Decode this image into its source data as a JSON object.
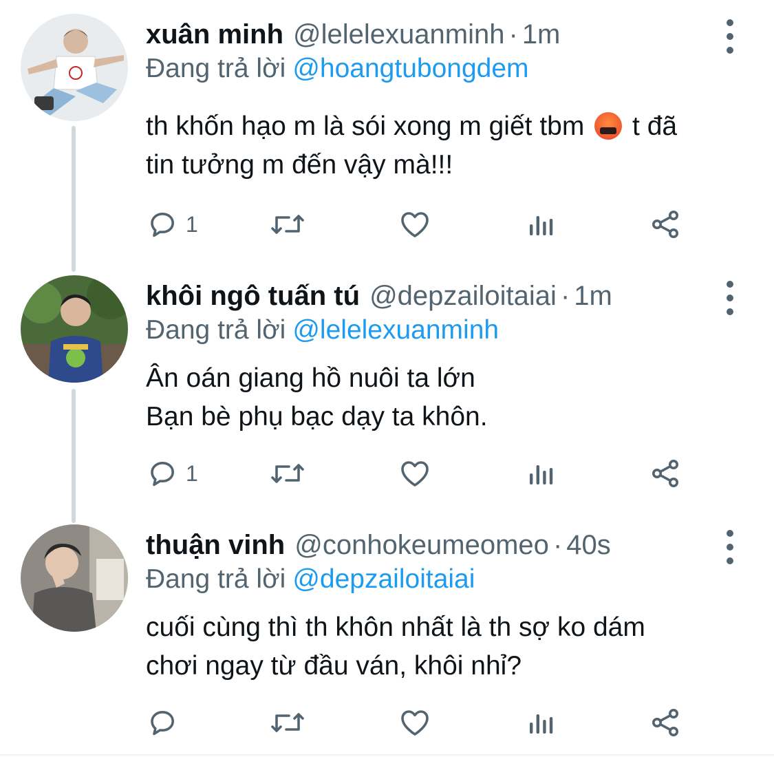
{
  "tweets": [
    {
      "name": "xuân minh",
      "handle": "@lelelexuanminh",
      "separator": "·",
      "time": "1m",
      "reply_prefix": "Đang trả lời",
      "reply_to": "@hoangtubongdem",
      "lines": [
        "th khốn hạo m là sói xong m giết tbm",
        "tin tưởng m đến vậy mà!!!"
      ],
      "line1_suffix": "t đã",
      "reply_count": "1",
      "emoji_icon": "face-with-symbols-on-mouth-icon"
    },
    {
      "name": "khôi ngô tuấn tú",
      "handle": "@depzailoitaiai",
      "separator": "·",
      "time": "1m",
      "reply_prefix": "Đang trả lời",
      "reply_to": "@lelelexuanminh",
      "lines": [
        "Ân oán giang hồ nuôi ta lớn",
        "Bạn bè phụ bạc dạy ta khôn."
      ],
      "reply_count": "1"
    },
    {
      "name": "thuận vinh",
      "handle": "@conhokeumeomeo",
      "separator": "·",
      "time": "40s",
      "reply_prefix": "Đang trả lời",
      "reply_to": "@depzailoitaiai",
      "lines": [
        "cuối cùng thì th khôn nhất là th sợ ko dám",
        "chơi ngay từ đầu ván, khôi nhỉ?"
      ],
      "reply_count": ""
    }
  ],
  "icons": [
    "reply-icon",
    "retweet-icon",
    "like-icon",
    "views-icon",
    "share-icon",
    "more-icon"
  ],
  "colors": {
    "text": "#0f1419",
    "secondary": "#536471",
    "link": "#1d9bf0",
    "thread_line": "#cfd9de",
    "background": "#ffffff"
  }
}
